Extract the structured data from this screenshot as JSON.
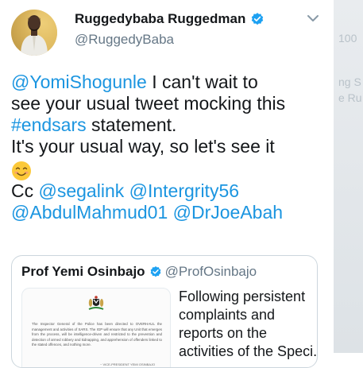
{
  "tweet": {
    "display_name": "Ruggedybaba Ruggedman",
    "handle": "@RuggedyBaba",
    "avatar_icon": "profile-photo",
    "verified_icon": "verified-badge-icon",
    "menu_icon": "chevron-down-icon",
    "body_lines": [
      {
        "link": "@YomiShogunle",
        "text": " I can't wait to"
      },
      {
        "text": "see your usual tweet mocking this"
      },
      {
        "link": "#endsars",
        "text": " statement."
      },
      {
        "text": "It's your usual way, so let's see it"
      },
      {
        "emoji": "smiling-face-emoji"
      },
      {
        "prefix": "Cc ",
        "mention1": "@segalink",
        "mention2": "@Intergrity56"
      },
      {
        "mention1": "@AbdulMahmud01",
        "mention2": "@DrJoeAbah"
      }
    ]
  },
  "quoted_tweet": {
    "display_name": "Prof Yemi Osinbajo",
    "handle": "@ProfOsinbajo",
    "text_lines": [
      "Following persistent",
      "complaints and",
      "reports on the",
      "activities of the Speci..."
    ],
    "thumbnail": {
      "icon": "nigeria-coat-of-arms-icon",
      "text": "The Inspector General of the Police has been directed to OVERHAUL the management and activities of SARS. The IGP will ensure that any Unit that emerges from the process, will be intelligence-driven and restricted to the prevention and detection of armed robbery and kidnapping, and apprehension of offenders linked to the stated offences, and nothing more.",
      "signature": "~ VICE-PRESIDENT YEMI OSINBAJO"
    }
  },
  "background": {
    "ghost_1": "100",
    "ghost_2": "ng S",
    "ghost_3": "e Ru"
  },
  "colors": {
    "link": "#1b95e0",
    "text": "#14171a",
    "secondary": "#657786",
    "border": "#ccd6dd"
  }
}
